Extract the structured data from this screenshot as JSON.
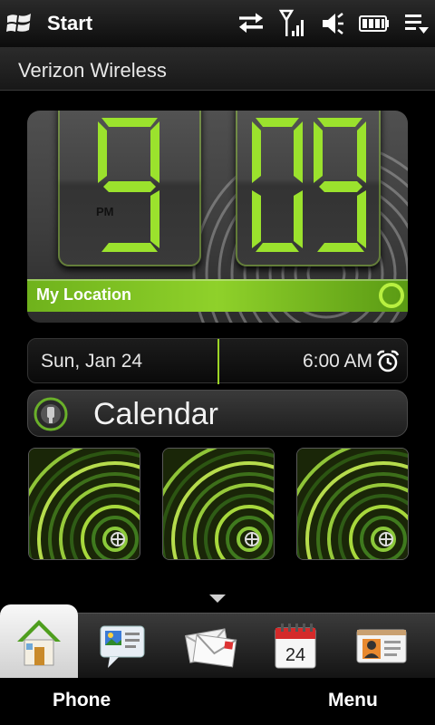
{
  "status_bar": {
    "title": "Start",
    "icons": [
      "windows-logo",
      "data-sync-icon",
      "signal-icon",
      "volume-vibrate-icon",
      "battery-icon",
      "menu-dropdown-icon"
    ]
  },
  "carrier": "Verizon Wireless",
  "clock": {
    "hour": "9",
    "minutes": "09",
    "meridiem": "PM",
    "location_label": "My Location",
    "accent_color": "#9be22d"
  },
  "date_alarm": {
    "date": "Sun, Jan 24",
    "alarm_time": "6:00 AM"
  },
  "calendar": {
    "label": "Calendar",
    "tab_day": "24"
  },
  "tiles": [
    "photo-tile-1",
    "photo-tile-2",
    "photo-tile-3"
  ],
  "tabs": [
    "home-icon",
    "messaging-icon",
    "mail-icon",
    "calendar-icon",
    "contacts-icon"
  ],
  "softkeys": {
    "left": "Phone",
    "right": "Menu"
  }
}
